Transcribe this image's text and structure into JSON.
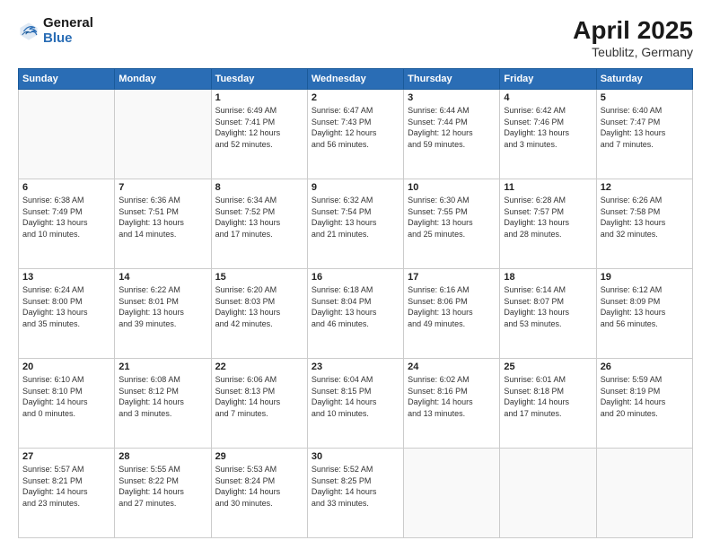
{
  "header": {
    "logo_general": "General",
    "logo_blue": "Blue",
    "title": "April 2025",
    "subtitle": "Teublitz, Germany"
  },
  "calendar": {
    "days_of_week": [
      "Sunday",
      "Monday",
      "Tuesday",
      "Wednesday",
      "Thursday",
      "Friday",
      "Saturday"
    ],
    "weeks": [
      [
        {
          "day": "",
          "info": ""
        },
        {
          "day": "",
          "info": ""
        },
        {
          "day": "1",
          "info": "Sunrise: 6:49 AM\nSunset: 7:41 PM\nDaylight: 12 hours\nand 52 minutes."
        },
        {
          "day": "2",
          "info": "Sunrise: 6:47 AM\nSunset: 7:43 PM\nDaylight: 12 hours\nand 56 minutes."
        },
        {
          "day": "3",
          "info": "Sunrise: 6:44 AM\nSunset: 7:44 PM\nDaylight: 12 hours\nand 59 minutes."
        },
        {
          "day": "4",
          "info": "Sunrise: 6:42 AM\nSunset: 7:46 PM\nDaylight: 13 hours\nand 3 minutes."
        },
        {
          "day": "5",
          "info": "Sunrise: 6:40 AM\nSunset: 7:47 PM\nDaylight: 13 hours\nand 7 minutes."
        }
      ],
      [
        {
          "day": "6",
          "info": "Sunrise: 6:38 AM\nSunset: 7:49 PM\nDaylight: 13 hours\nand 10 minutes."
        },
        {
          "day": "7",
          "info": "Sunrise: 6:36 AM\nSunset: 7:51 PM\nDaylight: 13 hours\nand 14 minutes."
        },
        {
          "day": "8",
          "info": "Sunrise: 6:34 AM\nSunset: 7:52 PM\nDaylight: 13 hours\nand 17 minutes."
        },
        {
          "day": "9",
          "info": "Sunrise: 6:32 AM\nSunset: 7:54 PM\nDaylight: 13 hours\nand 21 minutes."
        },
        {
          "day": "10",
          "info": "Sunrise: 6:30 AM\nSunset: 7:55 PM\nDaylight: 13 hours\nand 25 minutes."
        },
        {
          "day": "11",
          "info": "Sunrise: 6:28 AM\nSunset: 7:57 PM\nDaylight: 13 hours\nand 28 minutes."
        },
        {
          "day": "12",
          "info": "Sunrise: 6:26 AM\nSunset: 7:58 PM\nDaylight: 13 hours\nand 32 minutes."
        }
      ],
      [
        {
          "day": "13",
          "info": "Sunrise: 6:24 AM\nSunset: 8:00 PM\nDaylight: 13 hours\nand 35 minutes."
        },
        {
          "day": "14",
          "info": "Sunrise: 6:22 AM\nSunset: 8:01 PM\nDaylight: 13 hours\nand 39 minutes."
        },
        {
          "day": "15",
          "info": "Sunrise: 6:20 AM\nSunset: 8:03 PM\nDaylight: 13 hours\nand 42 minutes."
        },
        {
          "day": "16",
          "info": "Sunrise: 6:18 AM\nSunset: 8:04 PM\nDaylight: 13 hours\nand 46 minutes."
        },
        {
          "day": "17",
          "info": "Sunrise: 6:16 AM\nSunset: 8:06 PM\nDaylight: 13 hours\nand 49 minutes."
        },
        {
          "day": "18",
          "info": "Sunrise: 6:14 AM\nSunset: 8:07 PM\nDaylight: 13 hours\nand 53 minutes."
        },
        {
          "day": "19",
          "info": "Sunrise: 6:12 AM\nSunset: 8:09 PM\nDaylight: 13 hours\nand 56 minutes."
        }
      ],
      [
        {
          "day": "20",
          "info": "Sunrise: 6:10 AM\nSunset: 8:10 PM\nDaylight: 14 hours\nand 0 minutes."
        },
        {
          "day": "21",
          "info": "Sunrise: 6:08 AM\nSunset: 8:12 PM\nDaylight: 14 hours\nand 3 minutes."
        },
        {
          "day": "22",
          "info": "Sunrise: 6:06 AM\nSunset: 8:13 PM\nDaylight: 14 hours\nand 7 minutes."
        },
        {
          "day": "23",
          "info": "Sunrise: 6:04 AM\nSunset: 8:15 PM\nDaylight: 14 hours\nand 10 minutes."
        },
        {
          "day": "24",
          "info": "Sunrise: 6:02 AM\nSunset: 8:16 PM\nDaylight: 14 hours\nand 13 minutes."
        },
        {
          "day": "25",
          "info": "Sunrise: 6:01 AM\nSunset: 8:18 PM\nDaylight: 14 hours\nand 17 minutes."
        },
        {
          "day": "26",
          "info": "Sunrise: 5:59 AM\nSunset: 8:19 PM\nDaylight: 14 hours\nand 20 minutes."
        }
      ],
      [
        {
          "day": "27",
          "info": "Sunrise: 5:57 AM\nSunset: 8:21 PM\nDaylight: 14 hours\nand 23 minutes."
        },
        {
          "day": "28",
          "info": "Sunrise: 5:55 AM\nSunset: 8:22 PM\nDaylight: 14 hours\nand 27 minutes."
        },
        {
          "day": "29",
          "info": "Sunrise: 5:53 AM\nSunset: 8:24 PM\nDaylight: 14 hours\nand 30 minutes."
        },
        {
          "day": "30",
          "info": "Sunrise: 5:52 AM\nSunset: 8:25 PM\nDaylight: 14 hours\nand 33 minutes."
        },
        {
          "day": "",
          "info": ""
        },
        {
          "day": "",
          "info": ""
        },
        {
          "day": "",
          "info": ""
        }
      ]
    ]
  }
}
